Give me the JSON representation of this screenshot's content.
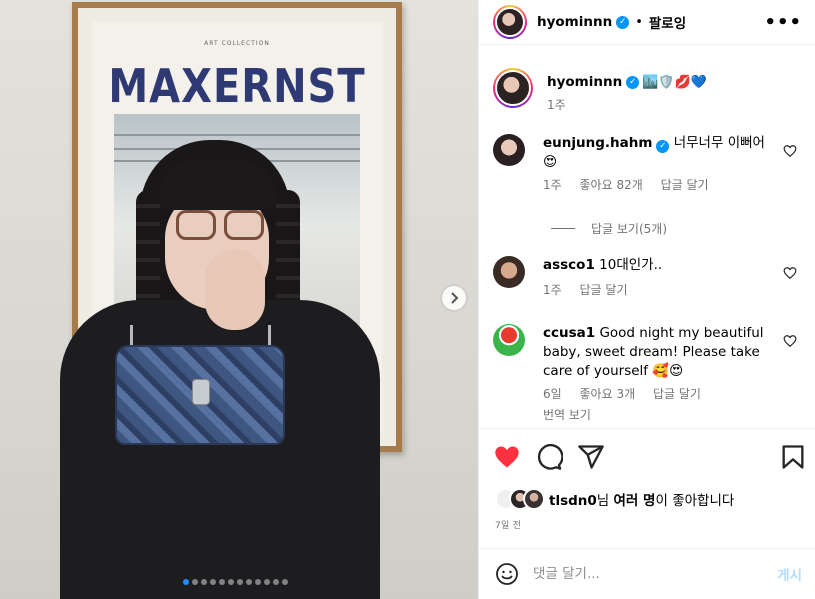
{
  "photo": {
    "art_subtitle": "ART COLLECTION",
    "art_title": "MAXERNST",
    "carousel": {
      "count": 12,
      "active_index": 0
    }
  },
  "header": {
    "username": "hyominnn",
    "dot": "•",
    "follow_label": "팔로잉",
    "more_label": "•••"
  },
  "caption": {
    "username": "hyominnn",
    "emojis": "🏙️🛡️💋💙",
    "time": "1주"
  },
  "comments": [
    {
      "username": "eunjung.hahm",
      "verified": true,
      "text": "너무너무 이뻐어",
      "emoji": "😍",
      "time": "1주",
      "likes": "좋아요 82개",
      "reply": "답글 달기",
      "view_replies": "답글 보기(5개)"
    },
    {
      "username": "assco1",
      "text": "10대인가..",
      "time": "1주",
      "reply": "답글 달기"
    },
    {
      "username": "ccusa1",
      "text": "Good night my beautiful baby, sweet dream! Please take care of yourself",
      "emoji": "🥰😍",
      "time": "6일",
      "likes": "좋아요 3개",
      "reply": "답글 달기",
      "translate": "번역 보기"
    }
  ],
  "likes": {
    "user": "tlsdn0",
    "suffix_1": "님",
    "many": "여러 명",
    "suffix_2": "이 좋아합니다"
  },
  "date": "7일 전",
  "add_comment": {
    "placeholder": "댓글 달기...",
    "post_label": "게시"
  },
  "colors": {
    "like_red": "#ff3040",
    "verified_blue": "#0095f6",
    "post_disabled": "#b3dbff",
    "muted": "#737373"
  },
  "icons": [
    "emoji-icon",
    "heart-icon",
    "comment-icon",
    "share-icon",
    "bookmark-icon",
    "chevron-right-icon",
    "verified-icon"
  ]
}
